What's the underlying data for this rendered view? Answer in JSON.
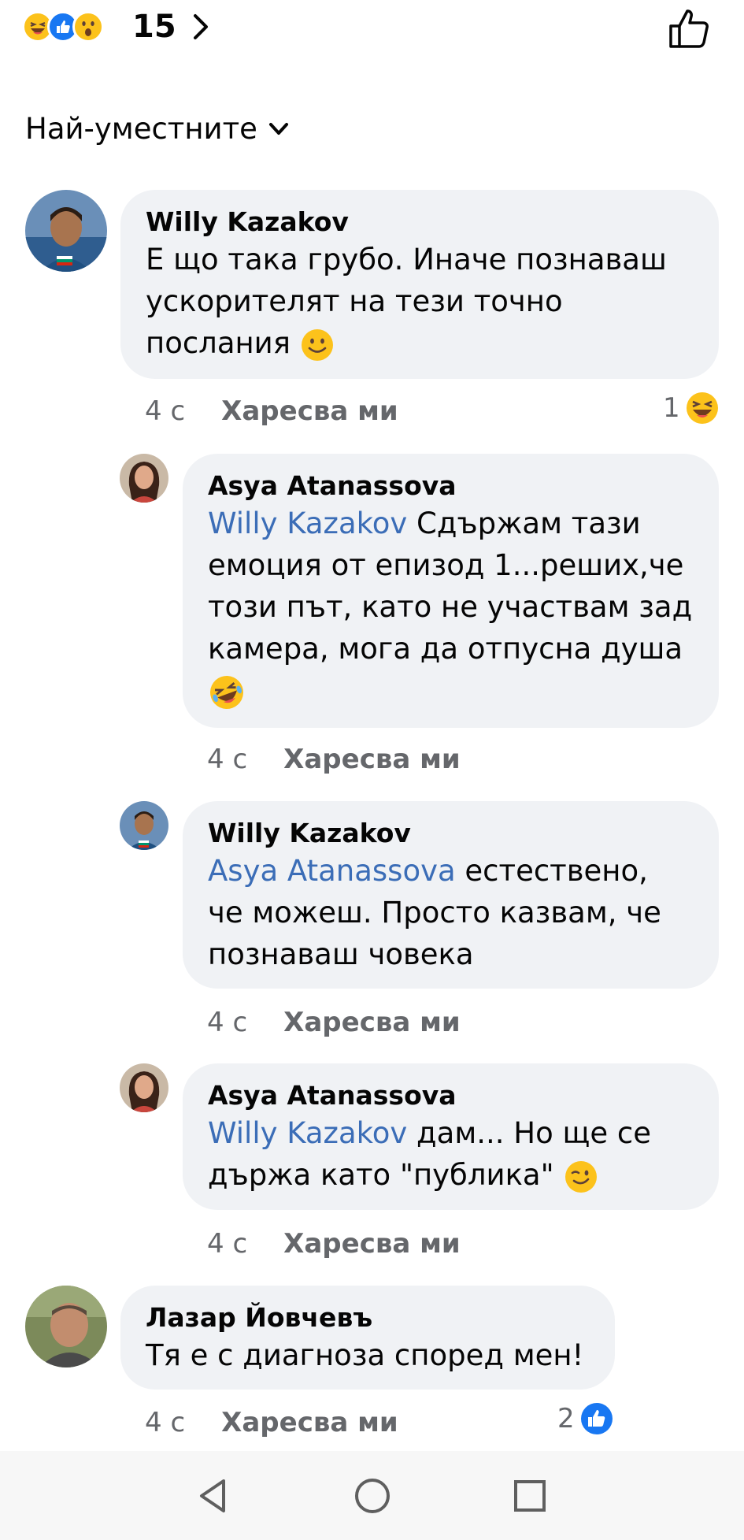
{
  "header": {
    "reaction_count": "15",
    "reactions": [
      "laugh-emoji",
      "like-icon",
      "wow-emoji"
    ]
  },
  "sort": {
    "label": "Най-уместните"
  },
  "comments": [
    {
      "author": "Willy Kazakov",
      "lines": [
        "Е що така грубо. Иначе познаваш",
        "ускорителят на тези точно",
        "послания"
      ],
      "trailing_emoji": "slight-smile-emoji",
      "time": "4 с",
      "like_label": "Харесва ми",
      "reaction_count": "1",
      "reaction_icon": "laugh-emoji"
    },
    {
      "author": "Asya Atanassova",
      "mention": "Willy Kazakov",
      "first_line_rest": " Сдържам тази",
      "lines": [
        "емоция от епизод 1...реших,че",
        "този път, като не участвам зад",
        "камера, мога да отпусна душа"
      ],
      "trailing_emoji": "rofl-emoji",
      "time": "4 с",
      "like_label": "Харесва ми"
    },
    {
      "author": "Willy Kazakov",
      "mention": "Asya Atanassova",
      "first_line_rest": " естествено,",
      "lines": [
        "че можеш. Просто казвам, че",
        "познаваш човека"
      ],
      "time": "4 с",
      "like_label": "Харесва ми"
    },
    {
      "author": "Asya Atanassova",
      "mention": "Willy Kazakov",
      "first_line_rest": " дам... Но ще се",
      "lines": [
        "държа като \"публика\""
      ],
      "trailing_emoji": "wink-emoji",
      "time": "4 с",
      "like_label": "Харесва ми"
    },
    {
      "author": "Лазар Йовчевъ",
      "lines": [
        "Тя е с диагноза според мен!"
      ],
      "time": "4 с",
      "like_label": "Харесва ми",
      "reaction_count": "2",
      "reaction_icon": "like-icon"
    }
  ],
  "colors": {
    "bubble": "#f0f2f5",
    "mention": "#3b6db7",
    "meta": "#65676b",
    "like_blue": "#1877f2",
    "emoji_yellow": "#fcc21b"
  },
  "navbar": {
    "buttons": [
      "back-icon",
      "home-icon",
      "recents-icon"
    ]
  }
}
